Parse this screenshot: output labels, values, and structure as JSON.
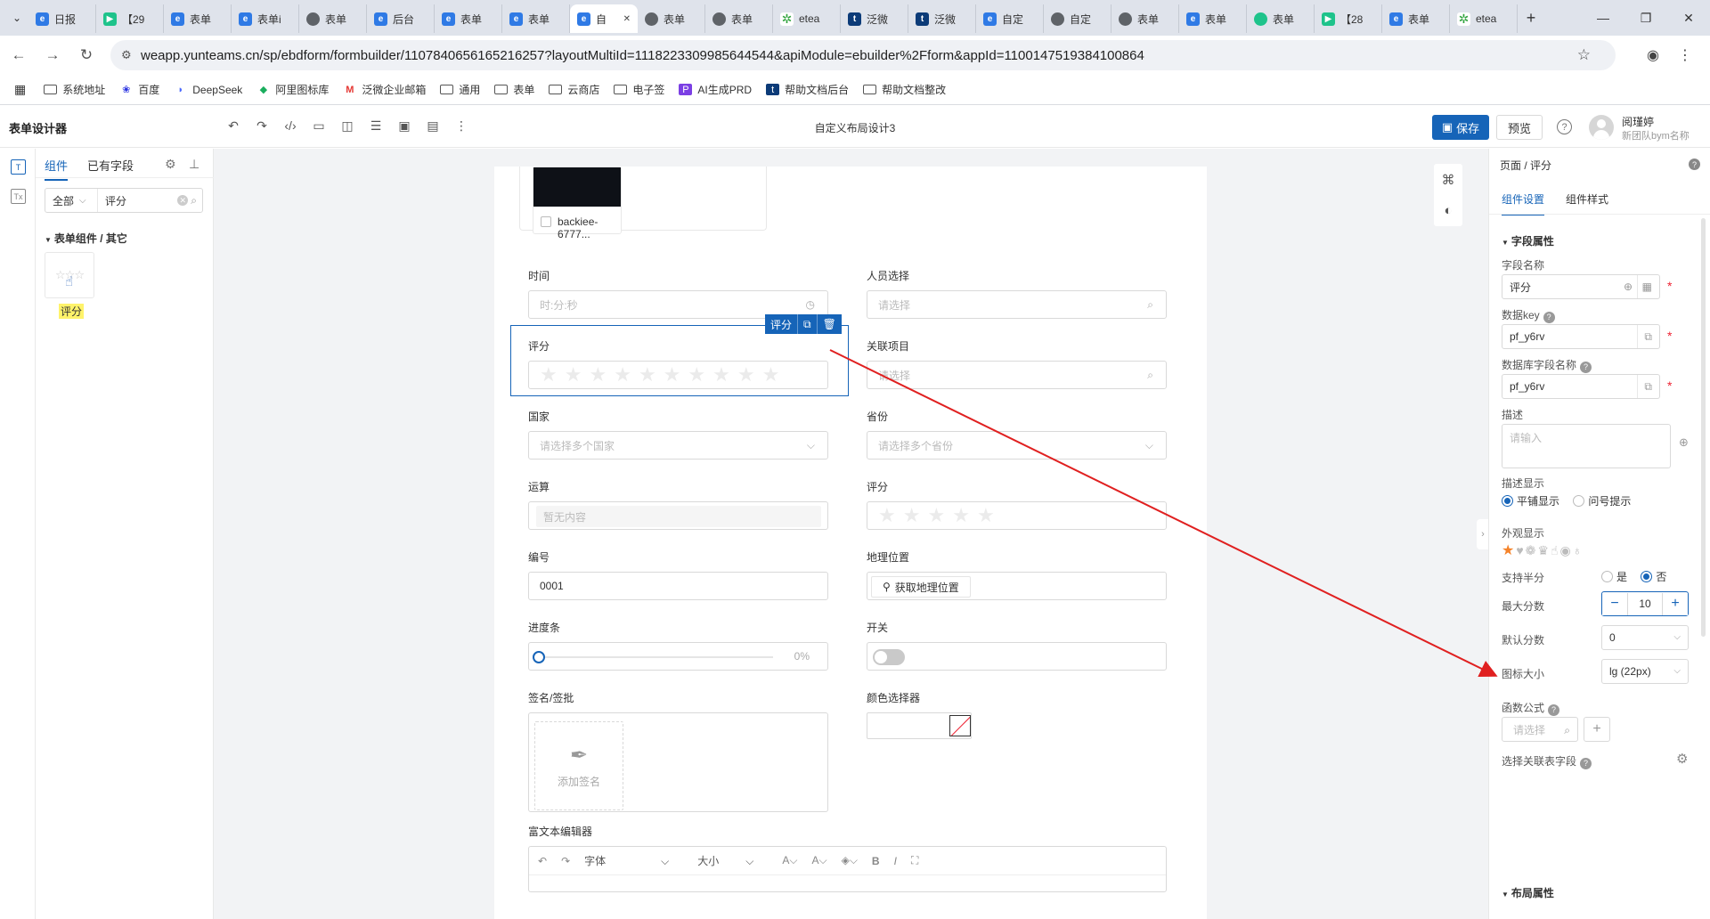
{
  "browser": {
    "tabs": [
      {
        "label": "日报",
        "icon": "e"
      },
      {
        "label": "【29",
        "icon": "p"
      },
      {
        "label": "表单",
        "icon": "e"
      },
      {
        "label": "表单i",
        "icon": "e"
      },
      {
        "label": "表单",
        "icon": "g"
      },
      {
        "label": "后台",
        "icon": "e"
      },
      {
        "label": "表单",
        "icon": "e"
      },
      {
        "label": "表单",
        "icon": "e"
      },
      {
        "label": "自",
        "icon": "e",
        "active": true
      },
      {
        "label": "表单",
        "icon": "g"
      },
      {
        "label": "表单",
        "icon": "g"
      },
      {
        "label": "etea",
        "icon": "s"
      },
      {
        "label": "泛微",
        "icon": "t"
      },
      {
        "label": "泛微",
        "icon": "t"
      },
      {
        "label": "自定",
        "icon": "e"
      },
      {
        "label": "自定",
        "icon": "g"
      },
      {
        "label": "表单",
        "icon": "g"
      },
      {
        "label": "表单",
        "icon": "e"
      },
      {
        "label": "表单",
        "icon": "c"
      },
      {
        "label": "【28",
        "icon": "p"
      },
      {
        "label": "表单",
        "icon": "e"
      },
      {
        "label": "etea",
        "icon": "s"
      }
    ],
    "url": "weapp.yunteams.cn/sp/ebdform/formbuilder/1107840656165216257?layoutMultiId=1118223309985644544&apiModule=ebuilder%2Fform&appId=1100147519384100864",
    "bookmarks": [
      "系统地址",
      "百度",
      "DeepSeek",
      "阿里图标库",
      "泛微企业邮箱",
      "通用",
      "表单",
      "云商店",
      "电子签",
      "AI生成PRD",
      "帮助文档后台",
      "帮助文档整改"
    ]
  },
  "app": {
    "title": "表单设计器",
    "center_title": "自定义布局设计3",
    "save_label": "保存",
    "preview_label": "预览",
    "user_name": "阅瑾婷",
    "user_team": "新团队bym名称"
  },
  "left_panel": {
    "tab_components": "组件",
    "tab_fields": "已有字段",
    "filter_select": "全部",
    "search_value": "评分",
    "group_title": "表单组件 / 其它",
    "component_label": "评分"
  },
  "form": {
    "image_filename": "backiee-6777...",
    "time_label": "时间",
    "time_placeholder": "时:分:秒",
    "person_label": "人员选择",
    "person_placeholder": "请选择",
    "rating_label": "评分",
    "related_label": "关联项目",
    "related_placeholder": "请选择",
    "country_label": "国家",
    "country_placeholder": "请选择多个国家",
    "province_label": "省份",
    "province_placeholder": "请选择多个省份",
    "calc_label": "运算",
    "calc_placeholder": "暂无内容",
    "rating2_label": "评分",
    "number_label": "编号",
    "number_value": "0001",
    "geo_label": "地理位置",
    "geo_button": "获取地理位置",
    "progress_label": "进度条",
    "progress_value": "0%",
    "switch_label": "开关",
    "sign_label": "签名/签批",
    "sign_button": "添加签名",
    "color_label": "颜色选择器",
    "rte_label": "富文本编辑器",
    "rte_font": "字体",
    "rte_size": "大小",
    "selected_tag": "评分"
  },
  "right_panel": {
    "breadcrumb": "页面 / 评分",
    "tab_settings": "组件设置",
    "tab_style": "组件样式",
    "section_field": "字段属性",
    "field_name_label": "字段名称",
    "field_name_value": "评分",
    "data_key_label": "数据key",
    "data_key_value": "pf_y6rv",
    "db_field_label": "数据库字段名称",
    "db_field_value": "pf_y6rv",
    "desc_label": "描述",
    "desc_placeholder": "请输入",
    "desc_display_label": "描述显示",
    "desc_opt_tile": "平铺显示",
    "desc_opt_tip": "问号提示",
    "appearance_label": "外观显示",
    "half_label": "支持半分",
    "half_yes": "是",
    "half_no": "否",
    "max_label": "最大分数",
    "max_value": "10",
    "default_label": "默认分数",
    "default_value": "0",
    "icon_size_label": "图标大小",
    "icon_size_value": "lg (22px)",
    "formula_label": "函数公式",
    "formula_placeholder": "请选择",
    "linked_label": "选择关联表字段",
    "section_layout": "布局属性"
  },
  "colors": {
    "primary": "#1664b8",
    "annotation_arrow": "#e02020",
    "rating_active": "#f5832a"
  }
}
